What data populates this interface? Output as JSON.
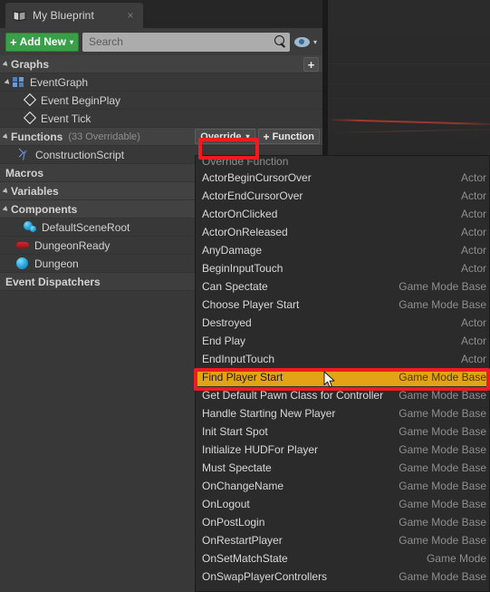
{
  "window": {
    "tab": {
      "label": "My Blueprint",
      "icon": "blueprint-book-icon",
      "close": "×"
    }
  },
  "toolbar": {
    "add_new_label": "Add New",
    "add_new_plus": "+",
    "add_new_caret": "▾",
    "search_placeholder": "Search",
    "search_value": "",
    "search_icon": "magnifier-icon",
    "eye_icon": "eye-icon",
    "eye_caret": "▾"
  },
  "tree": {
    "graphs": {
      "label": "Graphs",
      "add_button": "+",
      "event_graph": {
        "label": "EventGraph"
      },
      "events": [
        {
          "label": "Event BeginPlay"
        },
        {
          "label": "Event Tick"
        }
      ]
    },
    "functions": {
      "label": "Functions",
      "count_label": "(33 Overridable)",
      "override_button": "Override",
      "override_caret": "▾",
      "function_button": "Function",
      "function_plus": "+",
      "items": [
        {
          "label": "ConstructionScript"
        }
      ]
    },
    "macros": {
      "label": "Macros"
    },
    "variables": {
      "label": "Variables"
    },
    "components": {
      "label": "Components",
      "items": [
        {
          "label": "DefaultSceneRoot",
          "icon": "scene-root-sphere-icon"
        },
        {
          "label": "DungeonReady",
          "icon": "boolean-variable-icon"
        },
        {
          "label": "Dungeon",
          "icon": "object-sphere-icon"
        }
      ]
    },
    "event_dispatchers": {
      "label": "Event Dispatchers"
    }
  },
  "dropdown": {
    "header": "Override Function",
    "selected_index": 11,
    "rows": [
      {
        "name": "ActorBeginCursorOver",
        "category": "Actor"
      },
      {
        "name": "ActorEndCursorOver",
        "category": "Actor"
      },
      {
        "name": "ActorOnClicked",
        "category": "Actor"
      },
      {
        "name": "ActorOnReleased",
        "category": "Actor"
      },
      {
        "name": "AnyDamage",
        "category": "Actor"
      },
      {
        "name": "BeginInputTouch",
        "category": "Actor"
      },
      {
        "name": "Can Spectate",
        "category": "Game Mode Base"
      },
      {
        "name": "Choose Player Start",
        "category": "Game Mode Base"
      },
      {
        "name": "Destroyed",
        "category": "Actor"
      },
      {
        "name": "End Play",
        "category": "Actor"
      },
      {
        "name": "EndInputTouch",
        "category": "Actor"
      },
      {
        "name": "Find Player Start",
        "category": "Game Mode Base"
      },
      {
        "name": "Get Default Pawn Class for Controller",
        "category": "Game Mode Base"
      },
      {
        "name": "Handle Starting New Player",
        "category": "Game Mode Base"
      },
      {
        "name": "Init Start Spot",
        "category": "Game Mode Base"
      },
      {
        "name": "Initialize HUDFor Player",
        "category": "Game Mode Base"
      },
      {
        "name": "Must Spectate",
        "category": "Game Mode Base"
      },
      {
        "name": "OnChangeName",
        "category": "Game Mode Base"
      },
      {
        "name": "OnLogout",
        "category": "Game Mode Base"
      },
      {
        "name": "OnPostLogin",
        "category": "Game Mode Base"
      },
      {
        "name": "OnRestartPlayer",
        "category": "Game Mode Base"
      },
      {
        "name": "OnSetMatchState",
        "category": "Game Mode"
      },
      {
        "name": "OnSwapPlayerControllers",
        "category": "Game Mode Base"
      }
    ]
  },
  "colors": {
    "accent_green": "#3a9f48",
    "highlight_amber": "#e3a315",
    "annotation_red": "#ee1c22",
    "panel_bg": "#383838",
    "menu_bg": "#2b2b2b"
  }
}
